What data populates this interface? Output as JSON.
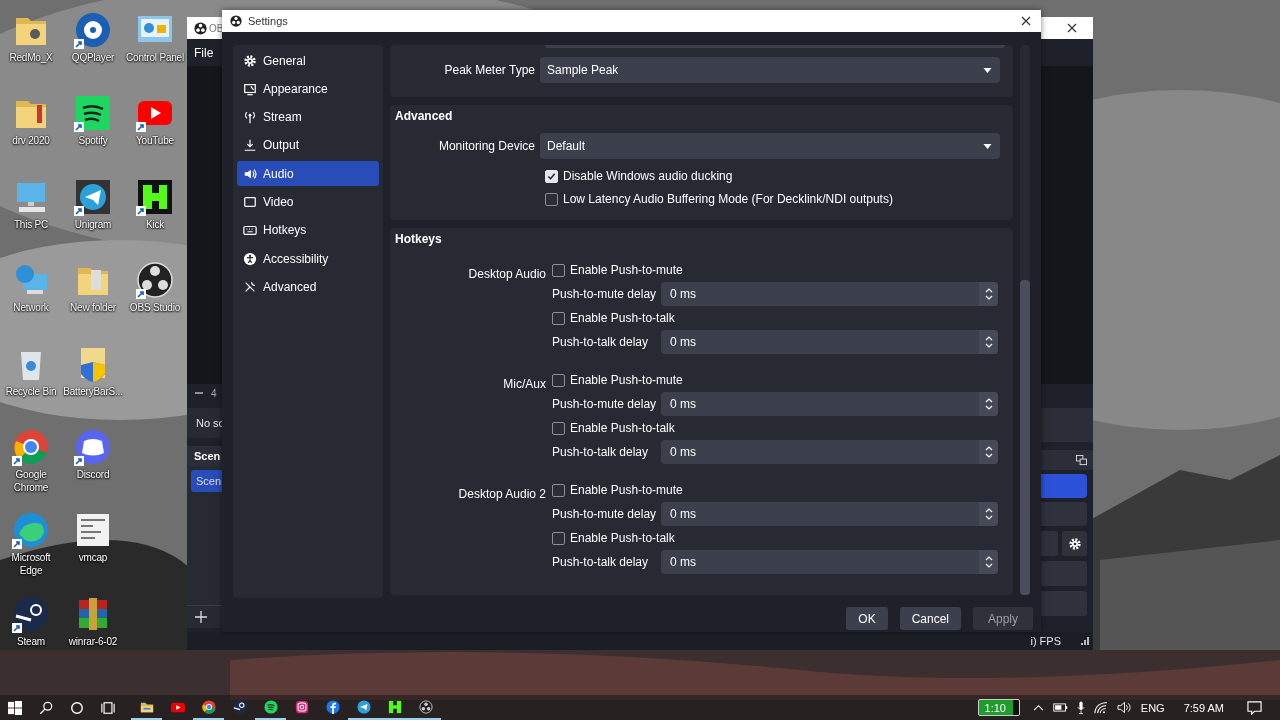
{
  "desktop_icons": [
    {
      "label": "RedMo_X",
      "shortcut": false
    },
    {
      "label": "drv 2020",
      "shortcut": false
    },
    {
      "label": "This PC",
      "shortcut": false
    },
    {
      "label": "Network",
      "shortcut": false
    },
    {
      "label": "Recycle Bin",
      "shortcut": false
    },
    {
      "label": "Google Chrome",
      "shortcut": true
    },
    {
      "label": "Microsoft Edge",
      "shortcut": true
    },
    {
      "label": "Steam",
      "shortcut": true
    },
    {
      "label": "QQPlayer",
      "shortcut": true
    },
    {
      "label": "Spotify",
      "shortcut": true
    },
    {
      "label": "Unigram",
      "shortcut": true
    },
    {
      "label": "New folder",
      "shortcut": false
    },
    {
      "label": "BatteryBarS...",
      "shortcut": false
    },
    {
      "label": "Discord",
      "shortcut": true
    },
    {
      "label": "vmcap",
      "shortcut": false
    },
    {
      "label": "winrar-6-02",
      "shortcut": false
    },
    {
      "label": "Control Panel",
      "shortcut": false
    },
    {
      "label": "YouTube",
      "shortcut": true
    },
    {
      "label": "Kick",
      "shortcut": true
    },
    {
      "label": "OBS Studio",
      "shortcut": true
    }
  ],
  "obs_window": {
    "title": "OB",
    "menu": [
      "File"
    ],
    "toolbar_text": "4",
    "sources_text": "No sc",
    "scenes_header": "Scen",
    "scenes": [
      {
        "label": "Scen",
        "selected": true
      }
    ],
    "dock_items": [
      {
        "selected": true
      },
      {
        "selected": false
      }
    ],
    "status_text": "i) FPS"
  },
  "settings": {
    "title": "Settings",
    "nav": [
      {
        "label": "General",
        "selected": false
      },
      {
        "label": "Appearance",
        "selected": false
      },
      {
        "label": "Stream",
        "selected": false
      },
      {
        "label": "Output",
        "selected": false
      },
      {
        "label": "Audio",
        "selected": true
      },
      {
        "label": "Video",
        "selected": false
      },
      {
        "label": "Hotkeys",
        "selected": false
      },
      {
        "label": "Accessibility",
        "selected": false
      },
      {
        "label": "Advanced",
        "selected": false
      }
    ],
    "peak_meter": {
      "label": "Peak Meter Type",
      "value": "Sample Peak"
    },
    "advanced": {
      "heading": "Advanced",
      "monitoring": {
        "label": "Monitoring Device",
        "value": "Default"
      },
      "options": [
        {
          "label": "Disable Windows audio ducking",
          "checked": true
        },
        {
          "label": "Low Latency Audio Buffering Mode (For Decklink/NDI outputs)",
          "checked": false
        }
      ]
    },
    "hotkeys": {
      "heading": "Hotkeys",
      "groups": [
        {
          "name": "Desktop Audio",
          "bindings": [
            {
              "label": "Enable Push-to-mute",
              "checked": false,
              "delay_label": "Push-to-mute delay",
              "delay": "0 ms"
            },
            {
              "label": "Enable Push-to-talk",
              "checked": false,
              "delay_label": "Push-to-talk delay",
              "delay": "0 ms"
            }
          ]
        },
        {
          "name": "Mic/Aux",
          "bindings": [
            {
              "label": "Enable Push-to-mute",
              "checked": false,
              "delay_label": "Push-to-mute delay",
              "delay": "0 ms"
            },
            {
              "label": "Enable Push-to-talk",
              "checked": false,
              "delay_label": "Push-to-talk delay",
              "delay": "0 ms"
            }
          ]
        },
        {
          "name": "Desktop Audio 2",
          "bindings": [
            {
              "label": "Enable Push-to-mute",
              "checked": false,
              "delay_label": "Push-to-mute delay",
              "delay": "0 ms"
            },
            {
              "label": "Enable Push-to-talk",
              "checked": false,
              "delay_label": "Push-to-talk delay",
              "delay": "0 ms"
            }
          ]
        }
      ]
    },
    "buttons": [
      {
        "label": "OK",
        "disabled": false
      },
      {
        "label": "Cancel",
        "disabled": false
      },
      {
        "label": "Apply",
        "disabled": true
      }
    ]
  },
  "taskbar": {
    "apps": [
      {
        "running": true
      },
      {
        "running": false
      },
      {
        "running": true
      },
      {
        "running": false
      },
      {
        "running": true
      },
      {
        "running": false
      },
      {
        "running": false
      },
      {
        "running": true
      },
      {
        "running": true
      },
      {
        "running": true
      }
    ],
    "battery_time": "1:10",
    "language": "ENG",
    "clock": "7:59 AM"
  }
}
